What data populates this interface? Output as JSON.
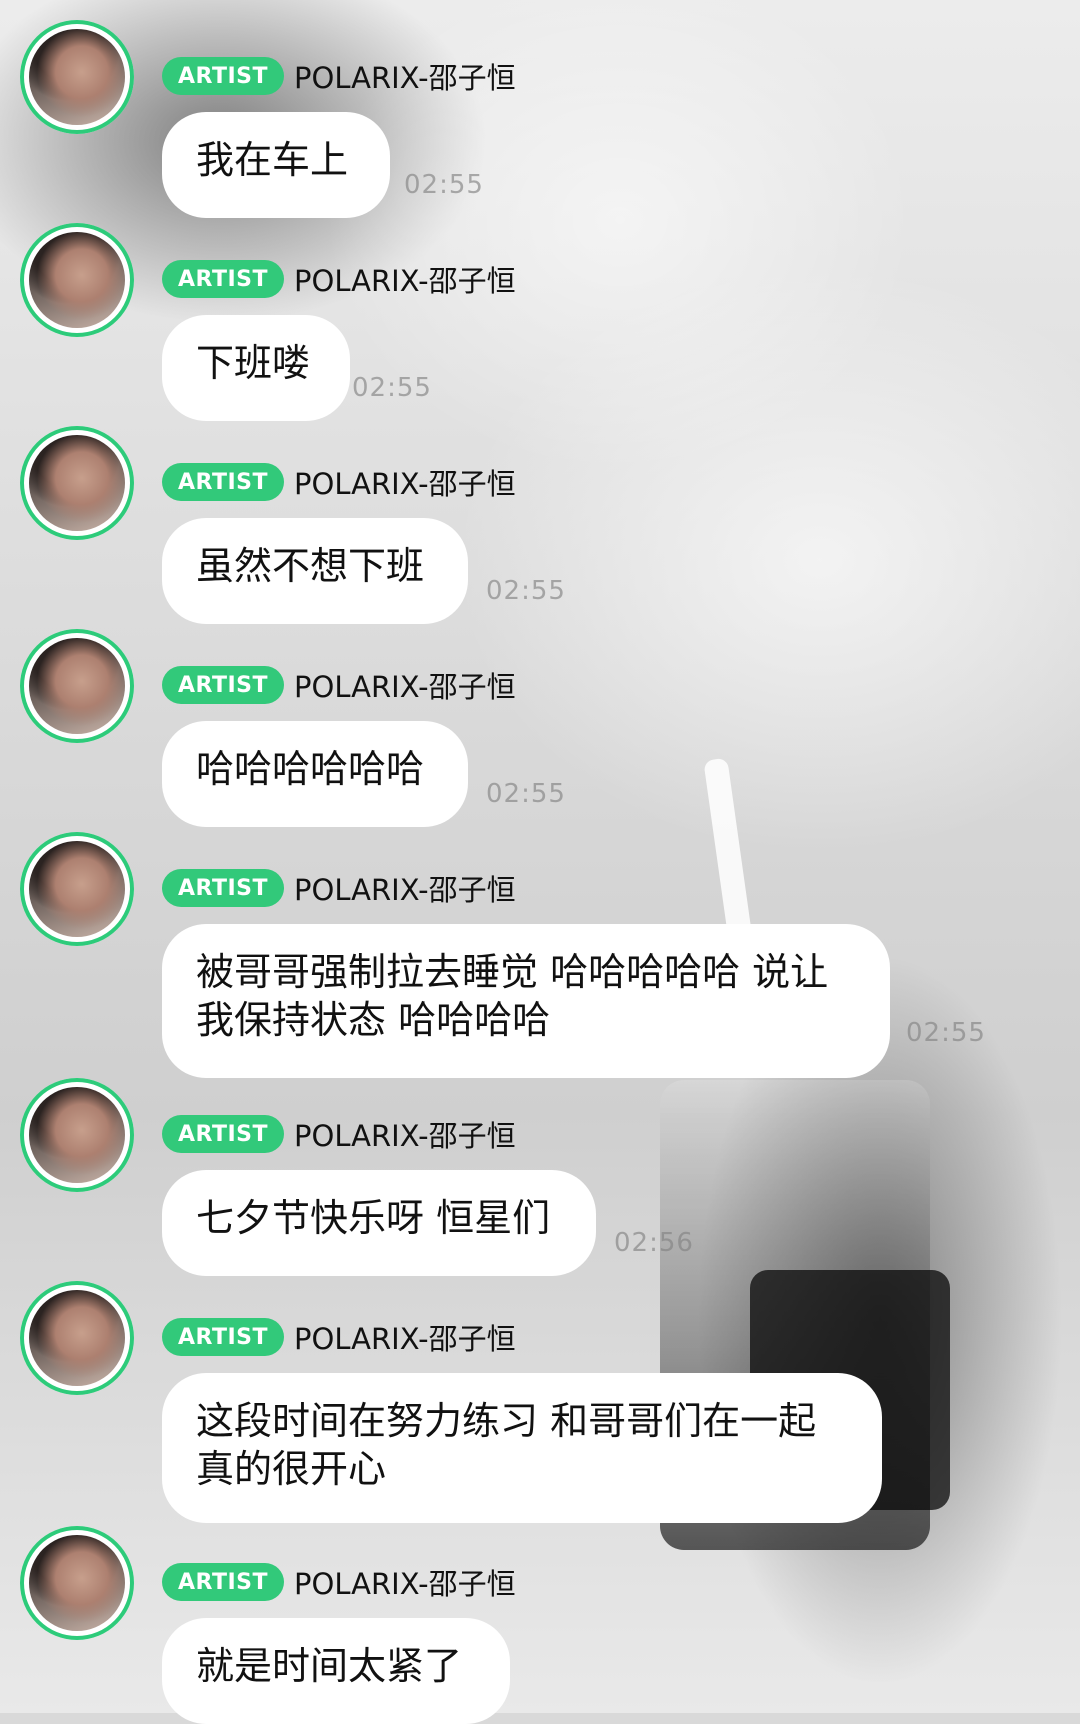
{
  "badge_label": "ARTIST",
  "sender_name": "POLARIX-邵子恒",
  "messages": [
    {
      "text": "我在车上",
      "time": "02:55"
    },
    {
      "text": "下班喽",
      "time": "02:55"
    },
    {
      "text": "虽然不想下班",
      "time": "02:55"
    },
    {
      "text": "哈哈哈哈哈哈",
      "time": "02:55"
    },
    {
      "text": "被哥哥强制拉去睡觉 哈哈哈哈哈 说让我保持状态 哈哈哈哈",
      "time": "02:55"
    },
    {
      "text": "七夕节快乐呀 恒星们",
      "time": "02:56"
    },
    {
      "text": "这段时间在努力练习 和哥哥们在一起真的很开心",
      "time": ""
    },
    {
      "text": "就是时间太紧了",
      "time": ""
    }
  ],
  "colors": {
    "accent_green": "#32c97a",
    "bubble_bg": "#ffffff",
    "timestamp": "#9a9a9a"
  },
  "icons": {
    "avatar": "artist-avatar"
  }
}
